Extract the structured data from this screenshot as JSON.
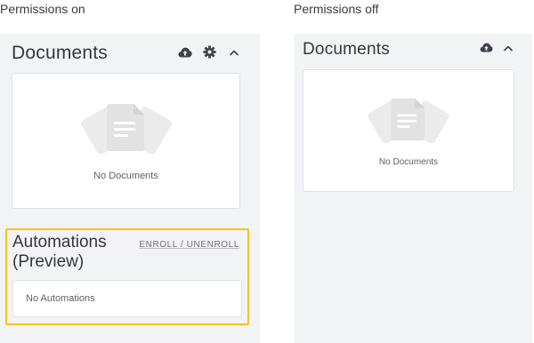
{
  "captions": {
    "left": "Permissions on",
    "right": "Permissions off"
  },
  "left_panel": {
    "documents": {
      "title": "Documents",
      "empty_text": "No Documents",
      "icons": [
        "cloud-upload-icon",
        "gear-icon",
        "chevron-up-icon"
      ]
    },
    "automations": {
      "title_line1": "Automations",
      "title_line2": "(Preview)",
      "link": "ENROLL / UNENROLL",
      "empty_text": "No Automations",
      "highlight_color": "#f4c41c"
    }
  },
  "right_panel": {
    "documents": {
      "title": "Documents",
      "empty_text": "No Documents",
      "icons": [
        "cloud-upload-icon",
        "chevron-up-icon"
      ]
    }
  }
}
